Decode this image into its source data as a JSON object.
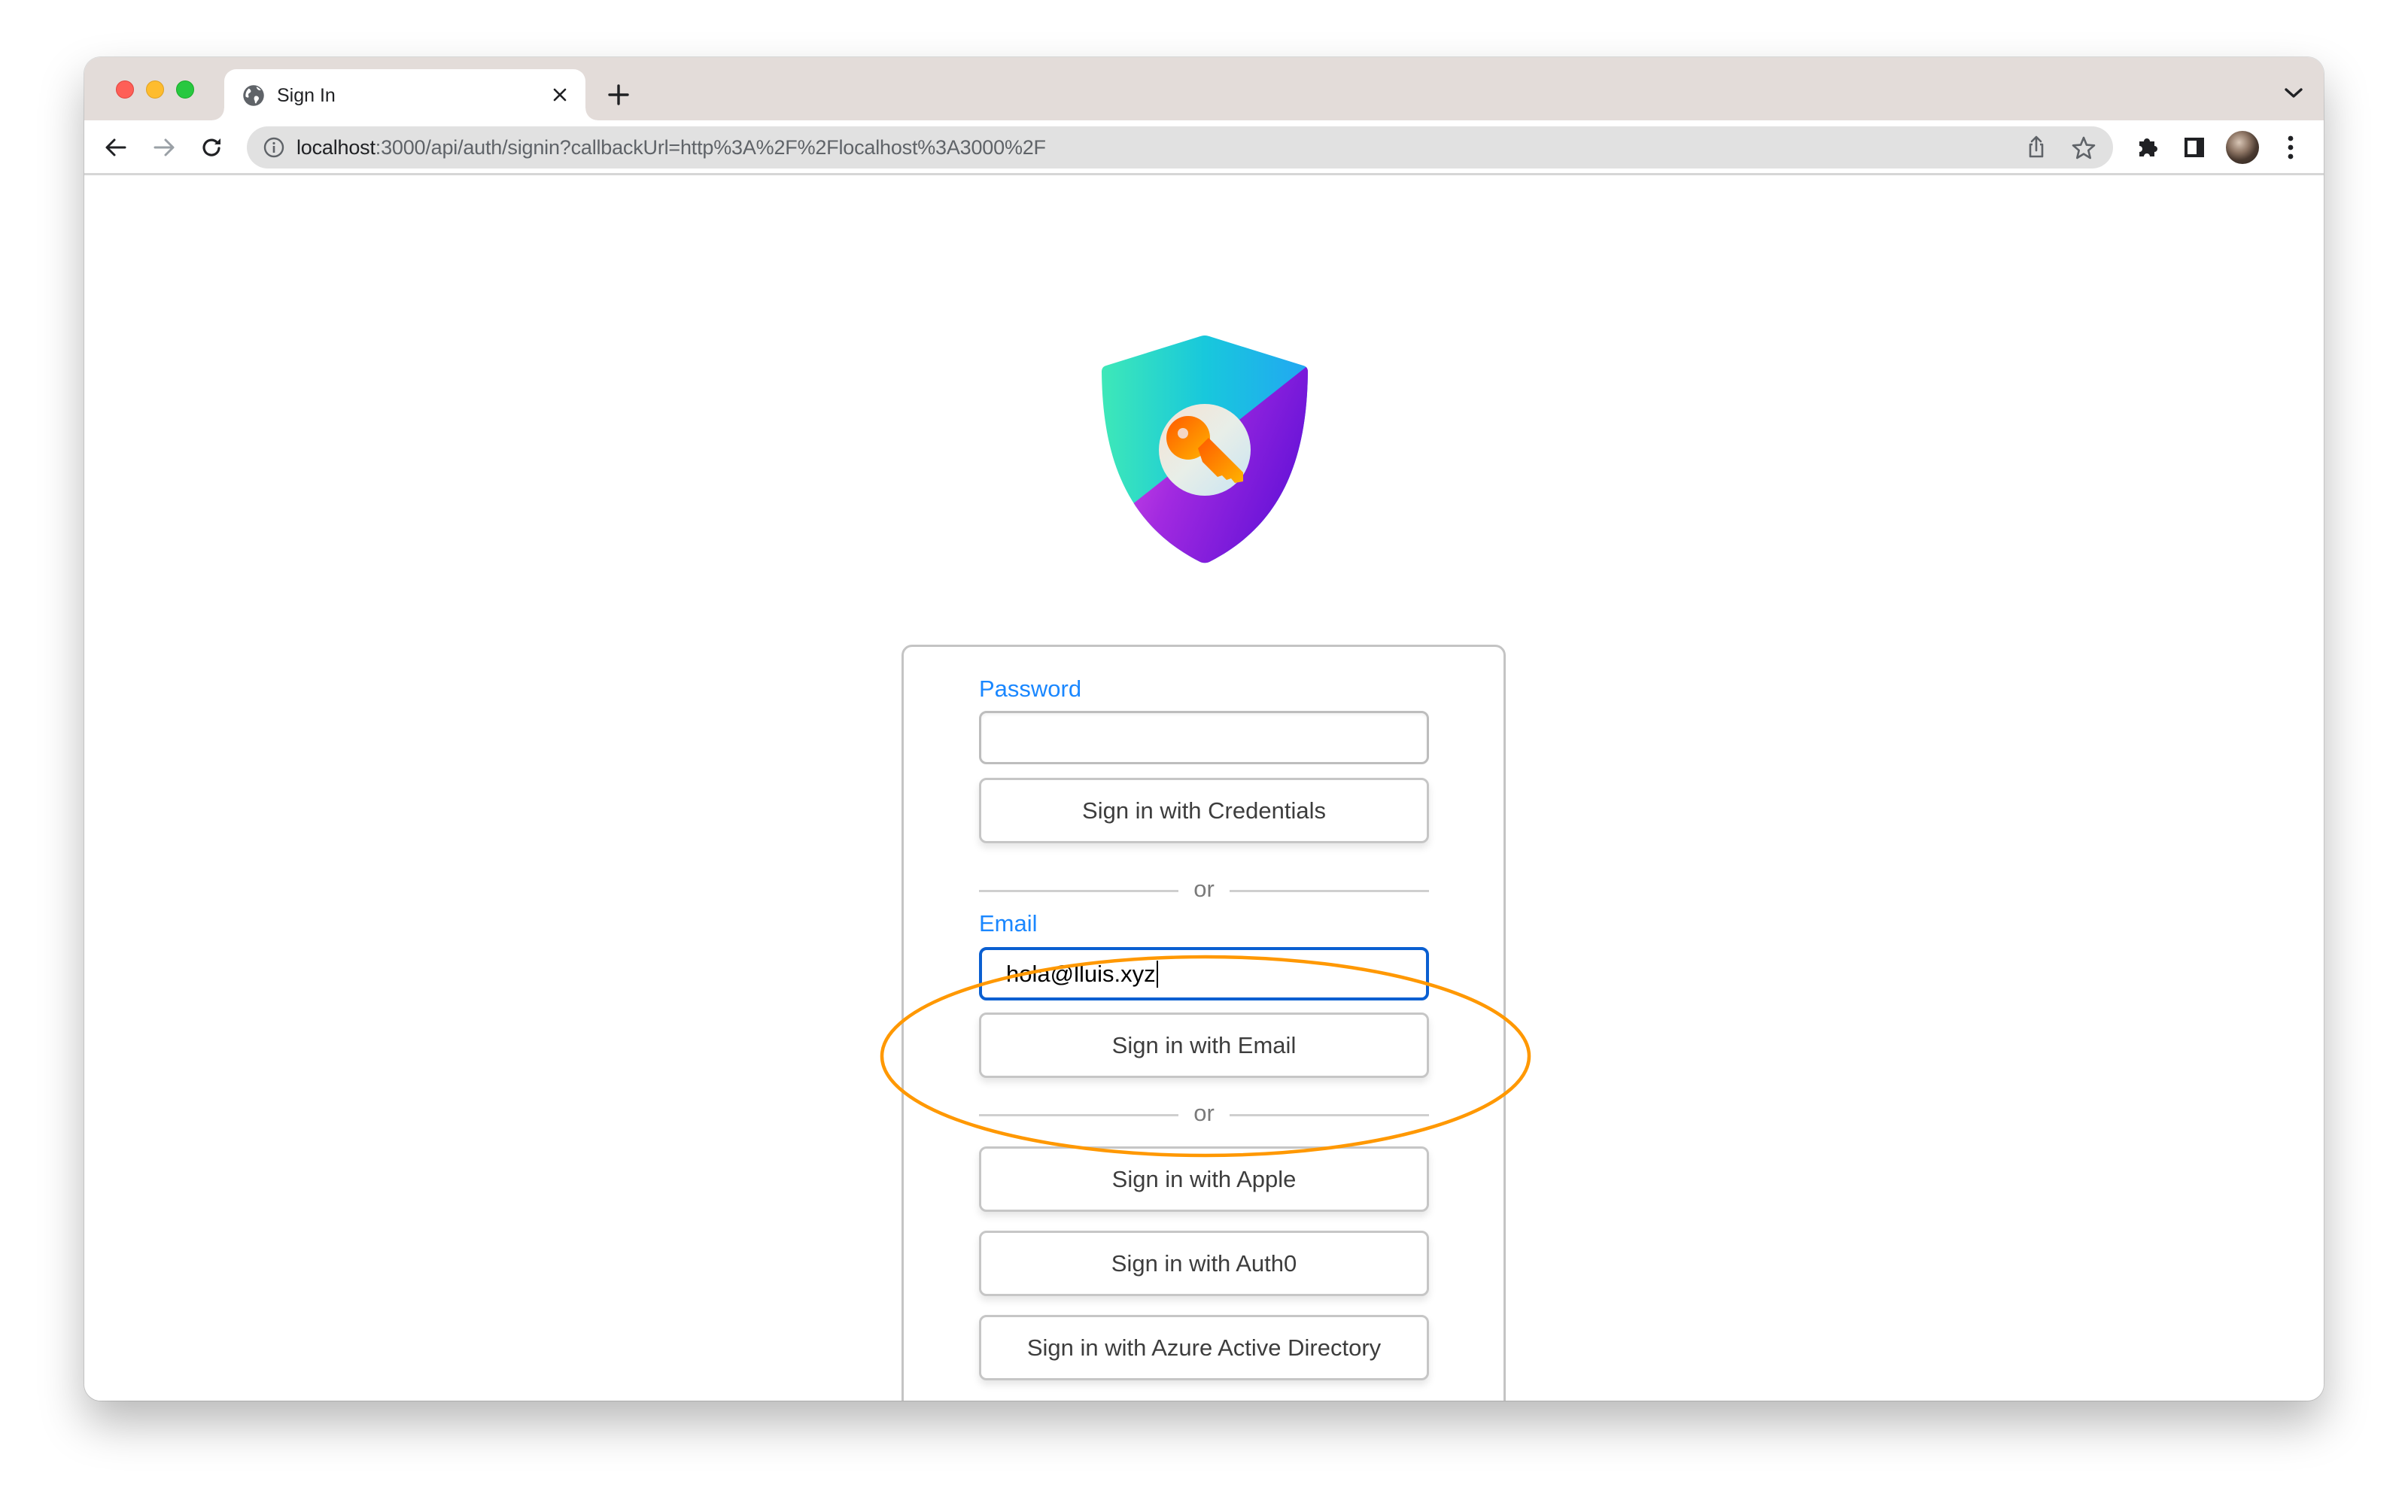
{
  "browser": {
    "traffic_lights": [
      "close",
      "minimize",
      "maximize"
    ],
    "tab": {
      "title": "Sign In",
      "favicon": "globe-icon",
      "close_icon": "close-icon"
    },
    "new_tab_icon": "plus-icon",
    "tab_search_icon": "chevron-down-icon",
    "nav": {
      "back_icon": "arrow-left-icon",
      "forward_icon": "arrow-right-icon",
      "reload_icon": "reload-icon"
    },
    "address_bar": {
      "info_icon": "info-icon",
      "url_host": "localhost",
      "url_rest": ":3000/api/auth/signin?callbackUrl=http%3A%2F%2Flocalhost%3A3000%2F",
      "share_icon": "share-icon",
      "bookmark_icon": "star-icon"
    },
    "toolbar_icons": [
      "puzzle-icon",
      "sidebar-icon",
      "avatar",
      "kebab-menu-icon"
    ]
  },
  "page": {
    "logo": "shield-key-logo",
    "password_label": "Password",
    "password_value": "",
    "credentials_button": "Sign in with Credentials",
    "divider_text": "or",
    "email_label": "Email",
    "email_value": "hola@lluis.xyz",
    "email_button": "Sign in with Email",
    "providers": [
      "Sign in with Apple",
      "Sign in with Auth0",
      "Sign in with Azure Active Directory"
    ]
  },
  "annotation": {
    "type": "ellipse-highlight",
    "color": "#ff9800",
    "target": "email"
  },
  "colors": {
    "label_blue": "#1a87ff",
    "focus_blue": "#0a5fd1",
    "tabstrip": "#e3dcd9"
  }
}
